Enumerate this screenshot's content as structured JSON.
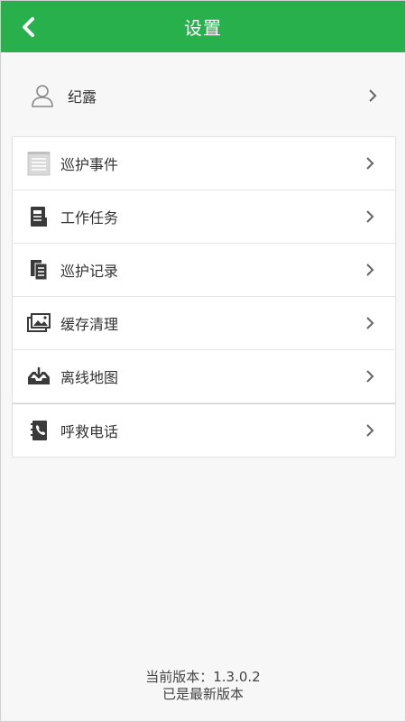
{
  "header": {
    "title": "设置",
    "back_icon": "chevron-left-icon",
    "color": "#27b04b"
  },
  "user": {
    "name": "纪露",
    "icon": "user-outline-icon"
  },
  "menu": {
    "items": [
      {
        "label": "巡护事件",
        "icon": "notepad-icon"
      },
      {
        "label": "工作任务",
        "icon": "task-document-icon"
      },
      {
        "label": "巡护记录",
        "icon": "records-icon"
      },
      {
        "label": "缓存清理",
        "icon": "image-stack-icon"
      },
      {
        "label": "离线地图",
        "icon": "download-tray-icon"
      },
      {
        "label": "呼救电话",
        "icon": "phone-book-icon"
      }
    ]
  },
  "footer": {
    "version_line": "当前版本：1.3.0.2",
    "status_line": "已是最新版本"
  }
}
